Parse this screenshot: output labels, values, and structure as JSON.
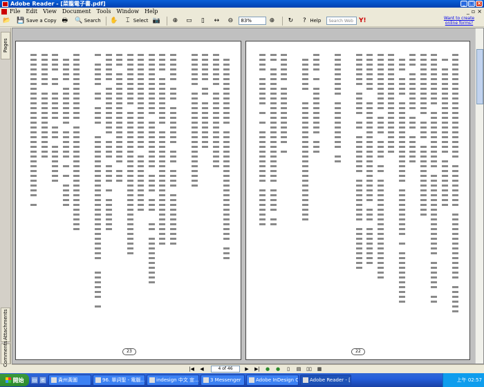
{
  "window": {
    "title": "Adobe Reader - [菜籠電子書.pdf]"
  },
  "menu": [
    "File",
    "Edit",
    "View",
    "Document",
    "Tools",
    "Window",
    "Help"
  ],
  "toolbar": {
    "save_copy": "Save a Copy",
    "search": "Search",
    "select": "Select",
    "zoom": "83%",
    "help": "Help",
    "search_web_placeholder": "Search Web"
  },
  "ad_link": "Want to create online forms?",
  "nav_tabs": [
    "Pages",
    "Attachments",
    "Comments"
  ],
  "pages": {
    "left_number": "23",
    "right_number": "22"
  },
  "page_nav": {
    "page_display": "4 of 46"
  },
  "taskbar": {
    "start": "開始",
    "tasks": [
      "貴州黃圖",
      "96. 單詞聖 - 電腦...",
      "indesign 中文 宣...",
      "3 Messenger",
      "Adobe InDesign CS...",
      "Adobe Reader - [菜..."
    ],
    "clock": "上午 02:57"
  }
}
